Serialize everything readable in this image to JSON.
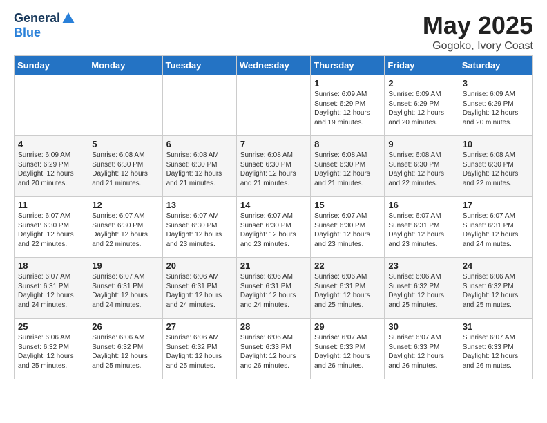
{
  "logo": {
    "general": "General",
    "blue": "Blue"
  },
  "title": "May 2025",
  "subtitle": "Gogoko, Ivory Coast",
  "days_of_week": [
    "Sunday",
    "Monday",
    "Tuesday",
    "Wednesday",
    "Thursday",
    "Friday",
    "Saturday"
  ],
  "weeks": [
    [
      {
        "day": "",
        "info": ""
      },
      {
        "day": "",
        "info": ""
      },
      {
        "day": "",
        "info": ""
      },
      {
        "day": "",
        "info": ""
      },
      {
        "day": "1",
        "info": "Sunrise: 6:09 AM\nSunset: 6:29 PM\nDaylight: 12 hours\nand 19 minutes."
      },
      {
        "day": "2",
        "info": "Sunrise: 6:09 AM\nSunset: 6:29 PM\nDaylight: 12 hours\nand 20 minutes."
      },
      {
        "day": "3",
        "info": "Sunrise: 6:09 AM\nSunset: 6:29 PM\nDaylight: 12 hours\nand 20 minutes."
      }
    ],
    [
      {
        "day": "4",
        "info": "Sunrise: 6:09 AM\nSunset: 6:29 PM\nDaylight: 12 hours\nand 20 minutes."
      },
      {
        "day": "5",
        "info": "Sunrise: 6:08 AM\nSunset: 6:30 PM\nDaylight: 12 hours\nand 21 minutes."
      },
      {
        "day": "6",
        "info": "Sunrise: 6:08 AM\nSunset: 6:30 PM\nDaylight: 12 hours\nand 21 minutes."
      },
      {
        "day": "7",
        "info": "Sunrise: 6:08 AM\nSunset: 6:30 PM\nDaylight: 12 hours\nand 21 minutes."
      },
      {
        "day": "8",
        "info": "Sunrise: 6:08 AM\nSunset: 6:30 PM\nDaylight: 12 hours\nand 21 minutes."
      },
      {
        "day": "9",
        "info": "Sunrise: 6:08 AM\nSunset: 6:30 PM\nDaylight: 12 hours\nand 22 minutes."
      },
      {
        "day": "10",
        "info": "Sunrise: 6:08 AM\nSunset: 6:30 PM\nDaylight: 12 hours\nand 22 minutes."
      }
    ],
    [
      {
        "day": "11",
        "info": "Sunrise: 6:07 AM\nSunset: 6:30 PM\nDaylight: 12 hours\nand 22 minutes."
      },
      {
        "day": "12",
        "info": "Sunrise: 6:07 AM\nSunset: 6:30 PM\nDaylight: 12 hours\nand 22 minutes."
      },
      {
        "day": "13",
        "info": "Sunrise: 6:07 AM\nSunset: 6:30 PM\nDaylight: 12 hours\nand 23 minutes."
      },
      {
        "day": "14",
        "info": "Sunrise: 6:07 AM\nSunset: 6:30 PM\nDaylight: 12 hours\nand 23 minutes."
      },
      {
        "day": "15",
        "info": "Sunrise: 6:07 AM\nSunset: 6:30 PM\nDaylight: 12 hours\nand 23 minutes."
      },
      {
        "day": "16",
        "info": "Sunrise: 6:07 AM\nSunset: 6:31 PM\nDaylight: 12 hours\nand 23 minutes."
      },
      {
        "day": "17",
        "info": "Sunrise: 6:07 AM\nSunset: 6:31 PM\nDaylight: 12 hours\nand 24 minutes."
      }
    ],
    [
      {
        "day": "18",
        "info": "Sunrise: 6:07 AM\nSunset: 6:31 PM\nDaylight: 12 hours\nand 24 minutes."
      },
      {
        "day": "19",
        "info": "Sunrise: 6:07 AM\nSunset: 6:31 PM\nDaylight: 12 hours\nand 24 minutes."
      },
      {
        "day": "20",
        "info": "Sunrise: 6:06 AM\nSunset: 6:31 PM\nDaylight: 12 hours\nand 24 minutes."
      },
      {
        "day": "21",
        "info": "Sunrise: 6:06 AM\nSunset: 6:31 PM\nDaylight: 12 hours\nand 24 minutes."
      },
      {
        "day": "22",
        "info": "Sunrise: 6:06 AM\nSunset: 6:31 PM\nDaylight: 12 hours\nand 25 minutes."
      },
      {
        "day": "23",
        "info": "Sunrise: 6:06 AM\nSunset: 6:32 PM\nDaylight: 12 hours\nand 25 minutes."
      },
      {
        "day": "24",
        "info": "Sunrise: 6:06 AM\nSunset: 6:32 PM\nDaylight: 12 hours\nand 25 minutes."
      }
    ],
    [
      {
        "day": "25",
        "info": "Sunrise: 6:06 AM\nSunset: 6:32 PM\nDaylight: 12 hours\nand 25 minutes."
      },
      {
        "day": "26",
        "info": "Sunrise: 6:06 AM\nSunset: 6:32 PM\nDaylight: 12 hours\nand 25 minutes."
      },
      {
        "day": "27",
        "info": "Sunrise: 6:06 AM\nSunset: 6:32 PM\nDaylight: 12 hours\nand 25 minutes."
      },
      {
        "day": "28",
        "info": "Sunrise: 6:06 AM\nSunset: 6:33 PM\nDaylight: 12 hours\nand 26 minutes."
      },
      {
        "day": "29",
        "info": "Sunrise: 6:07 AM\nSunset: 6:33 PM\nDaylight: 12 hours\nand 26 minutes."
      },
      {
        "day": "30",
        "info": "Sunrise: 6:07 AM\nSunset: 6:33 PM\nDaylight: 12 hours\nand 26 minutes."
      },
      {
        "day": "31",
        "info": "Sunrise: 6:07 AM\nSunset: 6:33 PM\nDaylight: 12 hours\nand 26 minutes."
      }
    ]
  ]
}
